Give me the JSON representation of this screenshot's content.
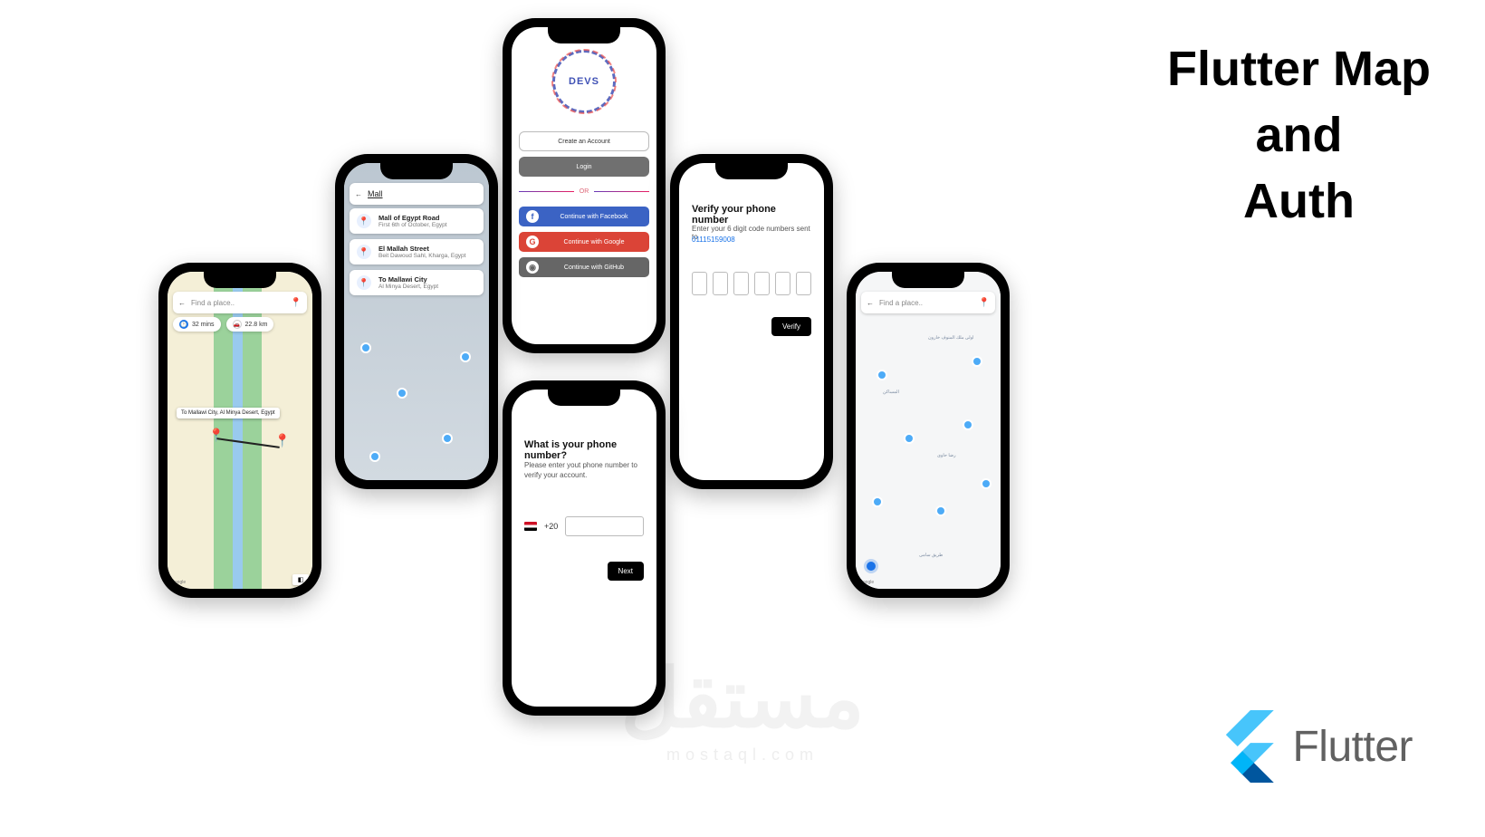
{
  "heading": {
    "line1": "Flutter Map",
    "line2": "and",
    "line3": "Auth"
  },
  "flutter": {
    "brand": "Flutter"
  },
  "watermark": {
    "text": "مستقل",
    "sub": "mostaql.com"
  },
  "p1": {
    "search_placeholder": "Find a place..",
    "duration": "32 mins",
    "distance": "22.8 km",
    "route_tooltip": "To Mallawi City, Al Minya Desert, Egypt",
    "google": "Google"
  },
  "p2": {
    "query": "Mall",
    "suggestions": [
      {
        "title": "Mall of Egypt Road",
        "subtitle": "First 6th of October, Egypt"
      },
      {
        "title": "El Mallah Street",
        "subtitle": "Beit Dawoud Sahl, Kharga, Egypt"
      },
      {
        "title": "To Mallawi City",
        "subtitle": "Al Minya Desert, Egypt"
      }
    ]
  },
  "p3": {
    "logo": "DEVS",
    "create": "Create an Account",
    "login": "Login",
    "or": "OR",
    "facebook": "Continue with Facebook",
    "google": "Continue with Google",
    "github": "Continue with GitHub"
  },
  "p4": {
    "title": "What is your phone number?",
    "subtitle": "Please enter yout phone number to verify your account.",
    "country_code": "+20",
    "next": "Next"
  },
  "p5": {
    "title": "Verify your phone number",
    "subtitle": "Enter your 6 digit code numbers sent to",
    "phone": "01115159008",
    "verify": "Verify"
  },
  "p6": {
    "search_placeholder": "Find a place..",
    "google": "Google"
  }
}
